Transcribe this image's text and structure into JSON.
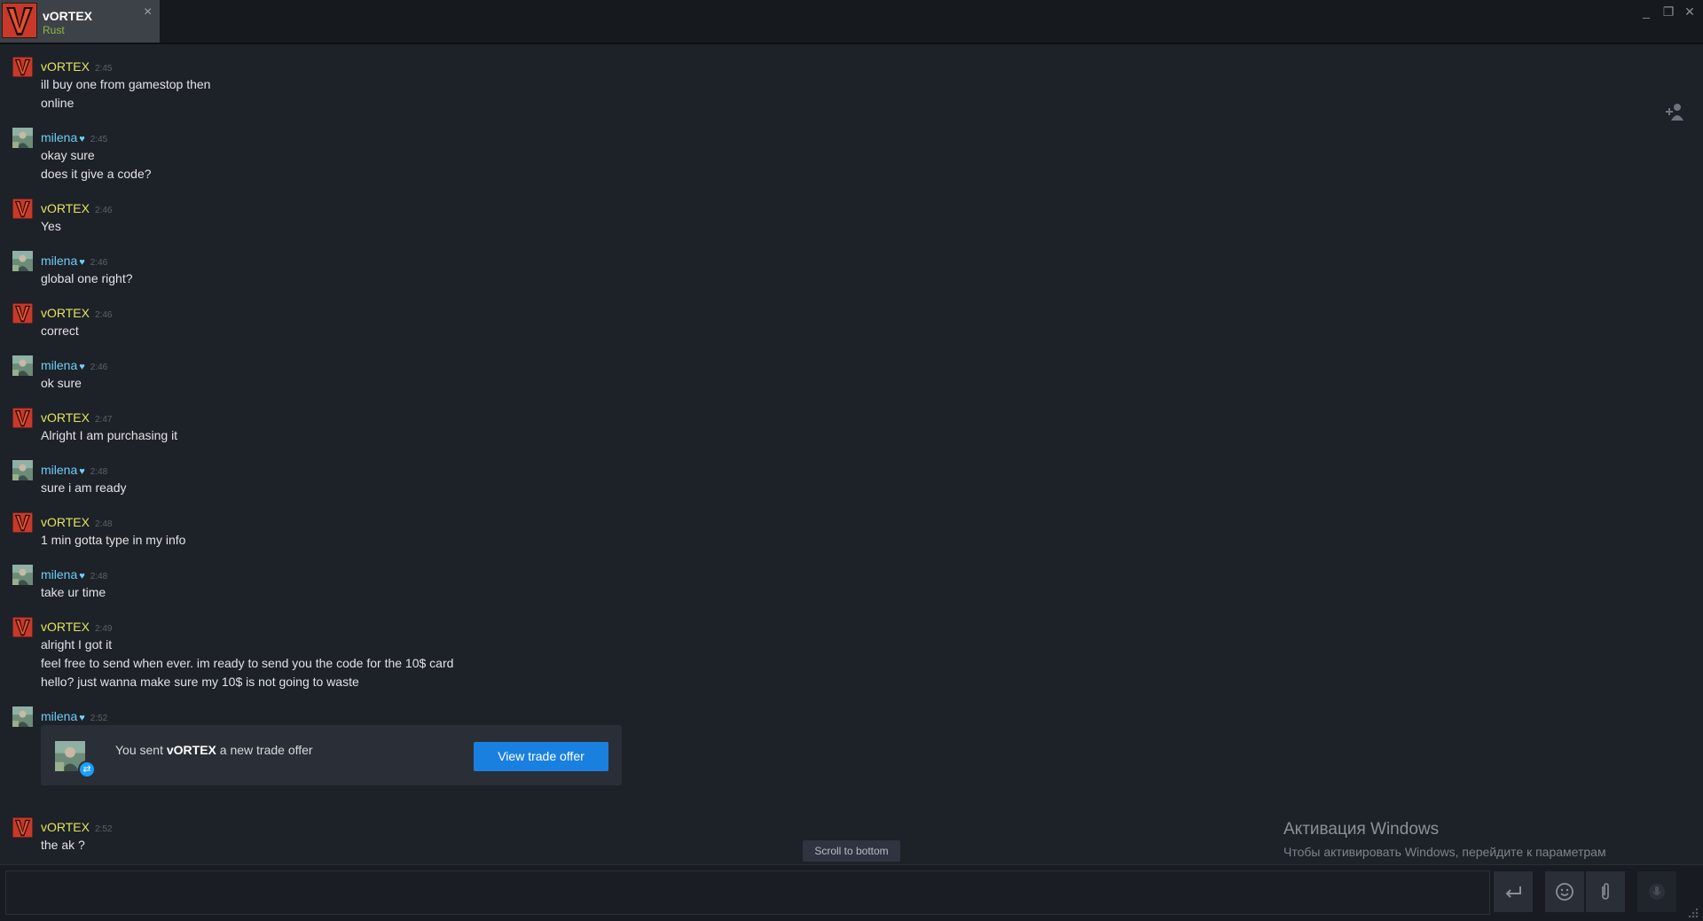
{
  "tab": {
    "name": "vORTEX",
    "game": "Rust",
    "close": "×"
  },
  "window_controls": {
    "minimize": "_",
    "restore": "❐",
    "close": "✕"
  },
  "messages": [
    {
      "author": "vORTEX",
      "time": "2:45",
      "lines": [
        "ill buy one from gamestop then",
        "online"
      ]
    },
    {
      "author": "milena",
      "time": "2:45",
      "lines": [
        "okay sure",
        "does it give a code?"
      ]
    },
    {
      "author": "vORTEX",
      "time": "2:46",
      "lines": [
        "Yes"
      ]
    },
    {
      "author": "milena",
      "time": "2:46",
      "lines": [
        "global one right?"
      ]
    },
    {
      "author": "vORTEX",
      "time": "2:46",
      "lines": [
        "correct"
      ]
    },
    {
      "author": "milena",
      "time": "2:46",
      "lines": [
        "ok sure"
      ]
    },
    {
      "author": "vORTEX",
      "time": "2:47",
      "lines": [
        "Alright I am purchasing it"
      ]
    },
    {
      "author": "milena",
      "time": "2:48",
      "lines": [
        "sure i am ready"
      ]
    },
    {
      "author": "vORTEX",
      "time": "2:48",
      "lines": [
        "1 min gotta type in my info"
      ]
    },
    {
      "author": "milena",
      "time": "2:48",
      "lines": [
        "take ur time"
      ]
    },
    {
      "author": "vORTEX",
      "time": "2:49",
      "lines": [
        "alright I got it",
        "feel free to send when ever. im ready to send you the code for the 10$ card",
        "hello? just wanna make sure my 10$ is not going to waste"
      ]
    },
    {
      "author": "milena",
      "time": "2:52",
      "lines": []
    },
    {
      "author": "vORTEX",
      "time": "2:52",
      "lines": [
        "the ak ?"
      ]
    }
  ],
  "heart": "♥",
  "trade_offer": {
    "prefix": "You sent ",
    "name": "vORTEX",
    "suffix": " a new trade offer",
    "button": "View trade offer"
  },
  "scroll_to_bottom": "Scroll to bottom",
  "composer": {
    "value": "",
    "placeholder": ""
  },
  "watermark": {
    "title": "Активация Windows",
    "subtitle": "Чтобы активировать Windows, перейдите к параметрам компьютера."
  },
  "colors": {
    "background": "#1d2128",
    "vortex_name": "#e4e45c",
    "milena_name": "#6dcff6",
    "button": "#1a80e0",
    "game_status": "#90ba3c"
  },
  "icons": [
    "vortex-avatar-icon",
    "milena-avatar-icon",
    "add-friend-icon",
    "enter-icon",
    "emoji-icon",
    "attach-icon",
    "voice-icon",
    "trade-icon"
  ]
}
